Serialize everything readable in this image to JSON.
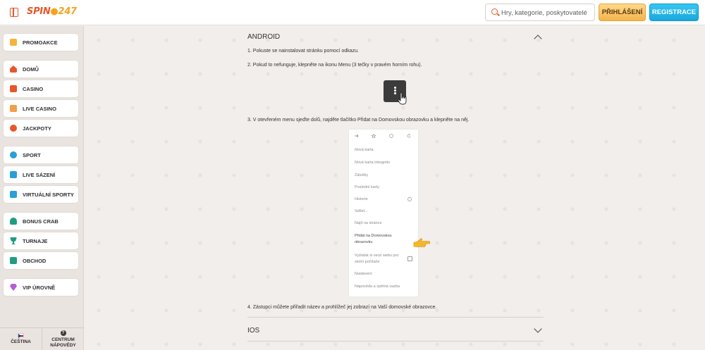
{
  "header": {
    "logo_main": "SPIN",
    "logo_accent": "247",
    "search_placeholder": "Hry, kategorie, poskytovatelé",
    "login_label": "PŘIHLÁŠENÍ",
    "register_label": "REGISTRACE"
  },
  "sidebar": {
    "items": [
      {
        "label": "PROMOAKCE",
        "icon": "gift-icon"
      },
      {
        "label": "DOMŮ",
        "icon": "home-icon"
      },
      {
        "label": "CASINO",
        "icon": "casino-icon"
      },
      {
        "label": "LIVE CASINO",
        "icon": "live-casino-icon"
      },
      {
        "label": "JACKPOTY",
        "icon": "jackpot-icon"
      },
      {
        "label": "SPORT",
        "icon": "sport-icon"
      },
      {
        "label": "LIVE SÁZENÍ",
        "icon": "live-betting-icon"
      },
      {
        "label": "VIRTUÁLNÍ SPORTY",
        "icon": "virtual-sports-icon"
      },
      {
        "label": "BONUS CRAB",
        "icon": "bonus-crab-icon"
      },
      {
        "label": "TURNAJE",
        "icon": "trophy-icon"
      },
      {
        "label": "OBCHOD",
        "icon": "shop-icon"
      },
      {
        "label": "VIP ÚROVNĚ",
        "icon": "vip-diamond-icon"
      }
    ],
    "footer": {
      "language_label": "ČEŠTINA",
      "help_line1": "CENTRUM",
      "help_line2": "NÁPOVĚDY",
      "help_icon_glyph": "?"
    }
  },
  "main": {
    "android_title": "ANDROID",
    "steps": [
      "1. Pokuste se nainstalovat stránku pomocí odkazu.",
      "2. Pokud to nefunguje, klepněte na ikonu Menu (3 tečky v pravém horním rohu).",
      "3. V otevřeném menu sjeďte dolů, najděte tlačítko Přidat na Domovskou obrazovku a klepněte na něj.",
      "4. Zástupci můžete přiřadit název a prohlížeč jej zobrazí na Vaší domovské obrazovce."
    ],
    "ios_title": "IOS",
    "browser_menu": [
      {
        "line1": "Nová karta",
        "line2": ""
      },
      {
        "line1": "Nová karta inkognito",
        "line2": ""
      },
      {
        "line1": "Záložky",
        "line2": ""
      },
      {
        "line1": "Poslední karty",
        "line2": ""
      },
      {
        "line1": "Historie",
        "line2": ""
      },
      {
        "line1": "Sdílet...",
        "line2": ""
      },
      {
        "line1": "Najít na stránce",
        "line2": ""
      },
      {
        "line1": "Přidat na Domovskou",
        "line2": "obrazovku"
      },
      {
        "line1": "Vyžádat si verzi webu pro",
        "line2": "stolní počítače"
      },
      {
        "line1": "Nastavení",
        "line2": ""
      },
      {
        "line1": "Nápověda a zpětná vazba",
        "line2": ""
      }
    ]
  },
  "colors": {
    "brand_orange": "#e8572a",
    "brand_yellow": "#f3a51d",
    "login_gold": "#f5b34c",
    "register_blue": "#1ba8dc"
  }
}
